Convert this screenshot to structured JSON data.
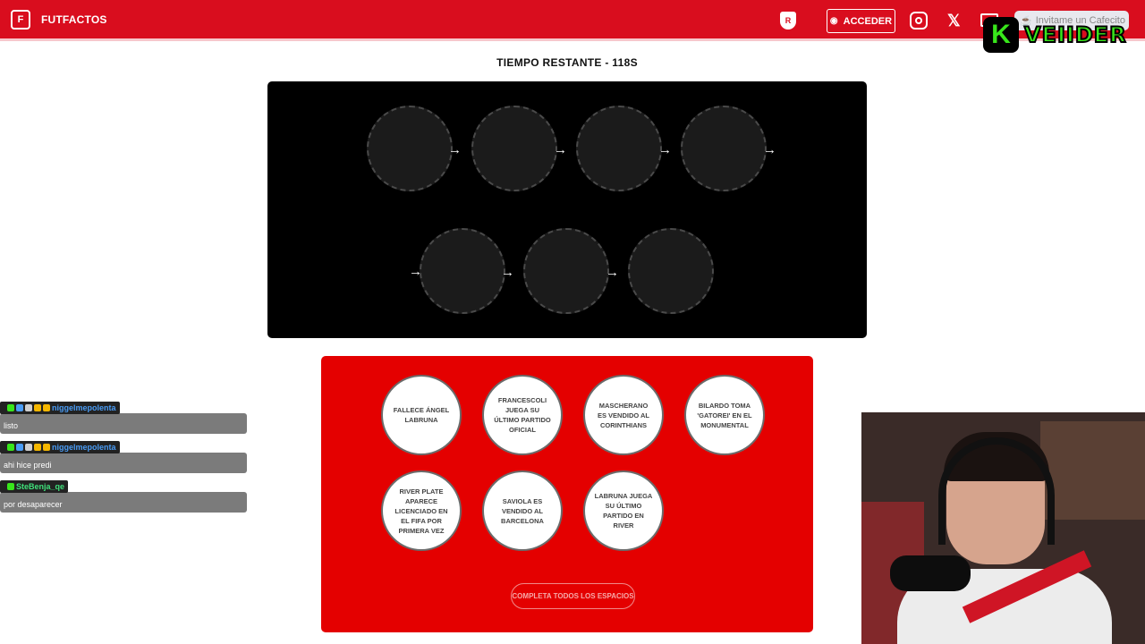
{
  "header": {
    "brand": "FUTFACTOS",
    "login_label": "ACCEDER",
    "cafecito_label": "Invitame un Cafecito"
  },
  "overlay": {
    "channel_name": "VEIIDER",
    "k_letter": "K"
  },
  "timer": {
    "label": "TIEMPO RESTANTE - 118S"
  },
  "cards": [
    {
      "label": "FALLECE ÁNGEL LABRUNA"
    },
    {
      "label": "FRANCESCOLI JUEGA SU ÚLTIMO PARTIDO OFICIAL"
    },
    {
      "label": "MASCHERANO ES VENDIDO AL CORINTHIANS"
    },
    {
      "label": "BILARDO TOMA 'GATOREI' EN EL MONUMENTAL"
    },
    {
      "label": "RIVER PLATE APARECE LICENCIADO EN EL FIFA POR PRIMERA VEZ"
    },
    {
      "label": "SAVIOLA ES VENDIDO AL BARCELONA"
    },
    {
      "label": "LABRUNA JUEGA SU ÚLTIMO PARTIDO EN RIVER"
    }
  ],
  "complete_button": "COMPLETA TODOS LOS ESPACIOS",
  "chat": [
    {
      "user": "niggelmepolenta",
      "text": "listo",
      "color": "#4a9cf5"
    },
    {
      "user": "niggelmepolenta",
      "text": "ahi hice predi",
      "color": "#4a9cf5"
    },
    {
      "user": "SteBenja_qe",
      "text": "por desaparecer",
      "color": "#3fe07a"
    }
  ],
  "colors": {
    "brand_red": "#d90d1e",
    "cards_red": "#e40000",
    "board_black": "#000000"
  },
  "icons": {
    "slot_arrow": "→",
    "x_logo": "𝕏"
  }
}
